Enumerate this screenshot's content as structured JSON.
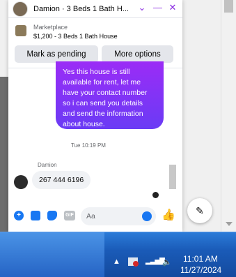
{
  "chat": {
    "title": "Damion · 3 Beds 1 Bath H...",
    "header_icons": [
      "chevron-down",
      "minimize",
      "close"
    ],
    "accent_color": "#8a2be2"
  },
  "listing": {
    "source": "Marketplace",
    "description": "$1,200 - 3 Beds 1 Bath House",
    "pending_label": "Mark as pending",
    "more_label": "More options"
  },
  "messages": {
    "outgoing_text": "Yes this house is still available for rent, let me have your contact number so i can send you details and send the information about house.",
    "timestamp": "Tue 10:19 PM",
    "sender_name": "Damion",
    "incoming_text": "267 444 6196"
  },
  "composer": {
    "placeholder": "Aa",
    "gif_label": "GIF"
  },
  "taskbar": {
    "time": "11:01 AM",
    "date": "11/27/2024"
  }
}
